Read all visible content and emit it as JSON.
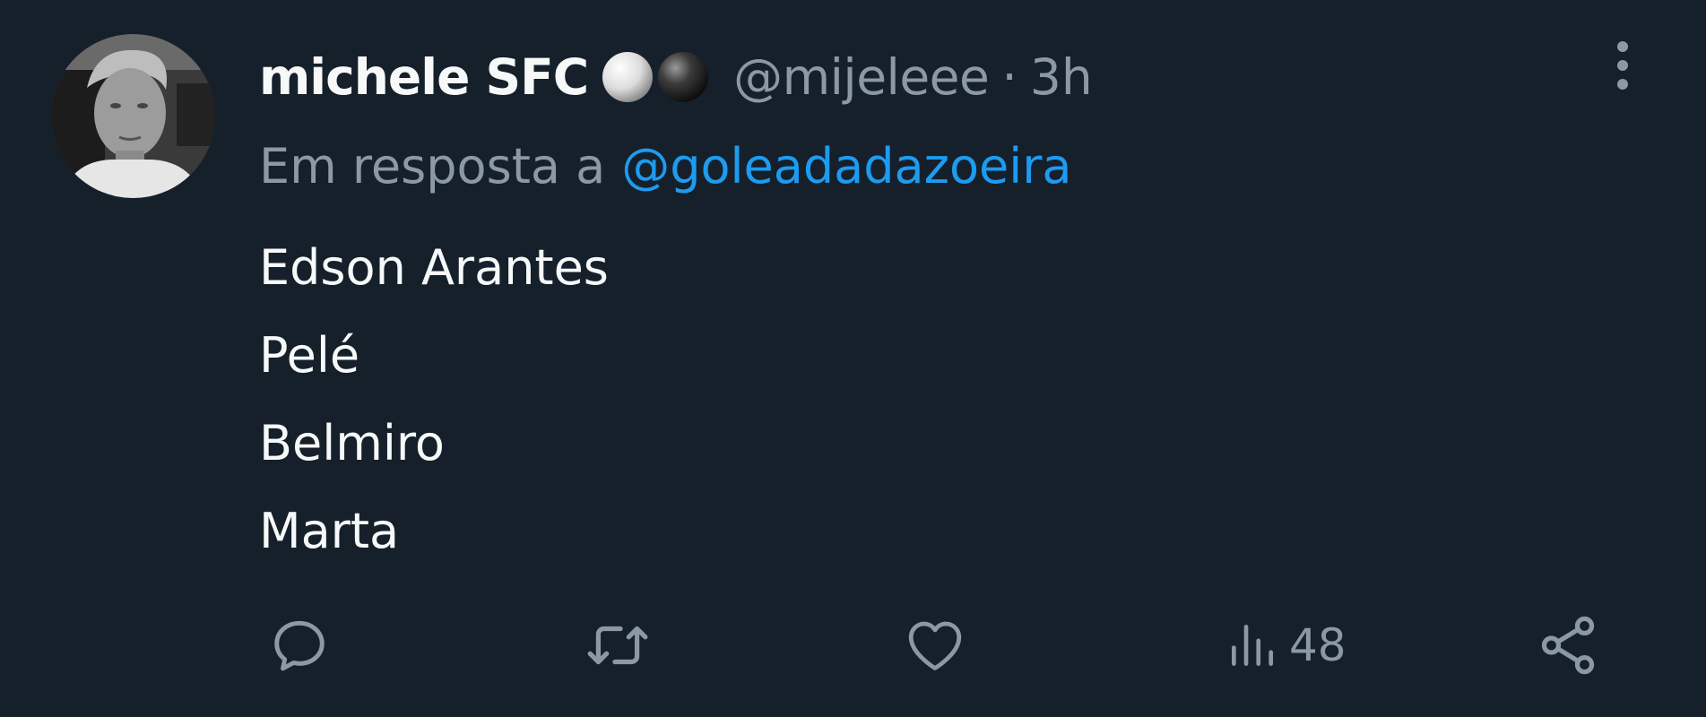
{
  "tweet": {
    "display_name": "michele SFC",
    "name_emojis": [
      "white-ball-emoji",
      "black-ball-emoji"
    ],
    "handle": "@mijeleee",
    "separator": "·",
    "time": "3h",
    "reply_prefix": "Em resposta a",
    "reply_mention": "@goleadadazoeira",
    "body_lines": [
      "Edson Arantes",
      "Pelé",
      "Belmiro",
      "Marta"
    ]
  },
  "actions": {
    "reply_icon": "reply-icon",
    "retweet_icon": "retweet-icon",
    "like_icon": "heart-icon",
    "views_icon": "views-bar-chart-icon",
    "views_count": "48",
    "share_icon": "share-icon"
  },
  "colors": {
    "background": "#15202b",
    "primary_text": "#f7f9f9",
    "secondary_text": "#8b98a5",
    "link": "#1d9bf0"
  }
}
